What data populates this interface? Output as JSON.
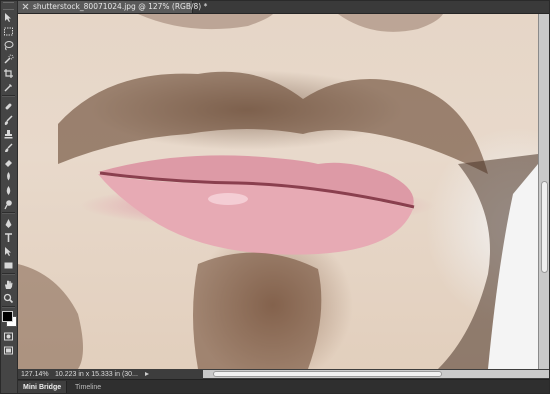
{
  "document": {
    "tab_title": "shutterstock_80071024.jpg @ 127% (RGB/8) *"
  },
  "status": {
    "zoom": "127.14%",
    "doc_info": "10.223 in x 15.333 in (30..."
  },
  "panels": {
    "tabs": [
      "Mini Bridge",
      "Timeline"
    ]
  },
  "toolbar": {
    "tools": [
      "move-tool-icon",
      "marquee-tool-icon",
      "lasso-tool-icon",
      "quick-selection-tool-icon",
      "crop-tool-icon",
      "eyedropper-tool-icon",
      "healing-brush-tool-icon",
      "brush-tool-icon",
      "clone-stamp-tool-icon",
      "history-brush-tool-icon",
      "eraser-tool-icon",
      "gradient-tool-icon",
      "blur-tool-icon",
      "dodge-tool-icon",
      "pen-tool-icon",
      "type-tool-icon",
      "path-selection-tool-icon",
      "rectangle-tool-icon",
      "hand-tool-icon",
      "zoom-tool-icon"
    ]
  },
  "scroll": {
    "vertical_thumb_start": 0.47,
    "vertical_thumb_end": 0.73,
    "horizontal_thumb_start": 0.03,
    "horizontal_thumb_end": 0.69
  },
  "colors": {
    "foreground": "#000000",
    "background": "#ffffff",
    "ui_panel": "#454545"
  }
}
